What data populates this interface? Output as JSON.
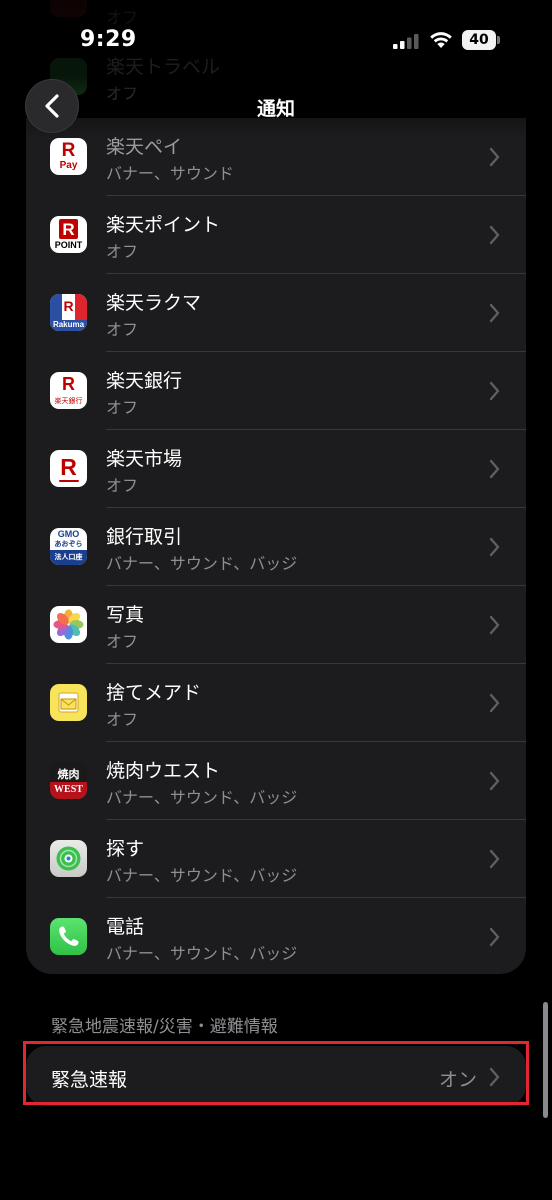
{
  "status_bar": {
    "time": "9:29",
    "battery": "40"
  },
  "nav": {
    "title": "通知",
    "back_icon": "chevron-left-icon"
  },
  "ghost_rows": [
    {
      "name": "",
      "status": "オフ"
    },
    {
      "name": "楽天トラベル",
      "status": "オフ"
    }
  ],
  "apps": [
    {
      "name": "楽天ペイ",
      "status": "バナー、サウンド",
      "icon": "rakuten-pay-icon"
    },
    {
      "name": "楽天ポイント",
      "status": "オフ",
      "icon": "rakuten-point-icon"
    },
    {
      "name": "楽天ラクマ",
      "status": "オフ",
      "icon": "rakuma-icon"
    },
    {
      "name": "楽天銀行",
      "status": "オフ",
      "icon": "rakuten-bank-icon"
    },
    {
      "name": "楽天市場",
      "status": "オフ",
      "icon": "rakuten-ichiba-icon"
    },
    {
      "name": "銀行取引",
      "status": "バナー、サウンド、バッジ",
      "icon": "gmo-aozora-icon"
    },
    {
      "name": "写真",
      "status": "オフ",
      "icon": "photos-icon"
    },
    {
      "name": "捨てメアド",
      "status": "オフ",
      "icon": "sute-meado-icon"
    },
    {
      "name": "焼肉ウエスト",
      "status": "バナー、サウンド、バッジ",
      "icon": "yakiniku-west-icon"
    },
    {
      "name": "探す",
      "status": "バナー、サウンド、バッジ",
      "icon": "find-my-icon"
    },
    {
      "name": "電話",
      "status": "バナー、サウンド、バッジ",
      "icon": "phone-icon"
    }
  ],
  "icon_text": {
    "pay_r": "R",
    "pay": "Pay",
    "point_r": "R",
    "point": "POINT",
    "rakuma_r": "R",
    "rakuma": "Rakuma",
    "bank_r": "R",
    "bank": "楽天銀行",
    "ichiba_r": "R",
    "gmo": "GMO",
    "gmo_sub": "あおぞら",
    "gmo_bottom": "法人口座",
    "west_top": "焼肉",
    "west": "WEST"
  },
  "emergency": {
    "section_title": "緊急地震速報/災害・避難情報",
    "label": "緊急速報",
    "value": "オン"
  },
  "colors": {
    "background": "#000000",
    "card": "#1c1c1e",
    "secondary_text": "#8e8e93",
    "highlight": "#e3262f",
    "rakuten_red": "#bf0000"
  }
}
